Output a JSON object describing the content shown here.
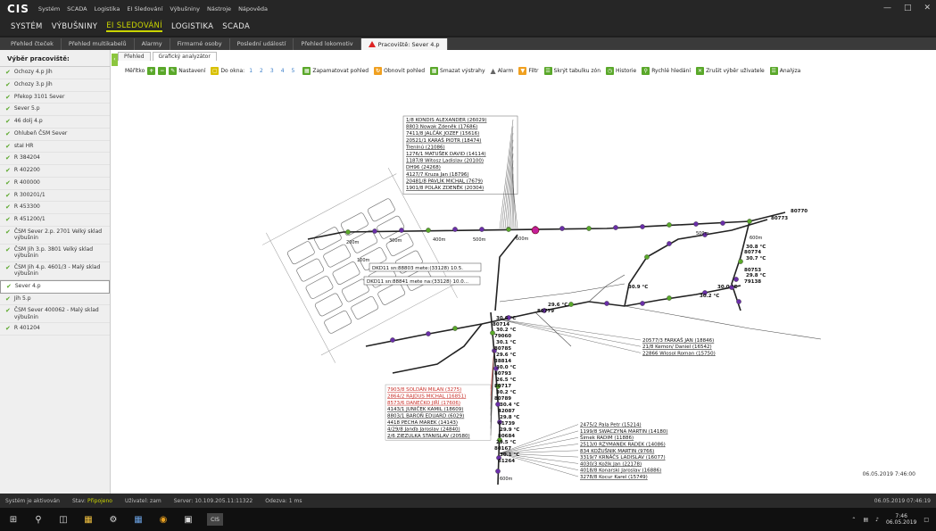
{
  "app": {
    "logo": "CIS",
    "top_menu": [
      "Systém",
      "SCADA",
      "Logistika",
      "EI Sledování",
      "Výbušniny",
      "Nástroje",
      "Nápověda"
    ],
    "main_menu": [
      "SYSTÉM",
      "VÝBUŠNINY",
      "EI SLEDOVÁNÍ",
      "LOGISTIKA",
      "SCADA"
    ],
    "active_main": "EI SLEDOVÁNÍ"
  },
  "tabs": [
    "Přehled čteček",
    "Přehled multikabelů",
    "Alarmy",
    "Firmarné osoby",
    "Poslední událostí",
    "Přehled lokomotiv",
    "Pracoviště: Sever 4.p"
  ],
  "sidebar": {
    "title": "Výběr pracoviště:",
    "items": [
      "Ochozy 4.p Jih",
      "Ochozy 3.p Jih",
      "Překop 3101 Sever",
      "Sever 5.p",
      "46 dolj 4.p",
      "Ohlubeň ČSM Sever",
      "staI HR",
      "R 384204",
      "R 402200",
      "R 400000",
      "R 300201/1",
      "R 453300",
      "R 451200/1",
      "ČSM Sever 2.p. 2701 Velký sklad výbušnin",
      "ČSM Jih 3.p. 3801 Velký sklad výbušnin",
      "ČSM Jih 4.p. 4601/3 - Malý sklad výbušnin",
      "Sever 4.p",
      "Jih 5.p",
      "ČSM Sever 400062 - Malý sklad výbušnin",
      "R 401204"
    ],
    "selected": "Sever 4.p"
  },
  "subtabs": [
    "Přehled",
    "Grafický analyzátor"
  ],
  "toolbar": {
    "meritko": "Měřítko",
    "nastaveni": "Nastavení",
    "do_okna": "Do okna:",
    "zoom_levels": [
      "1",
      "2",
      "3",
      "4",
      "5"
    ],
    "zapamatovat": "Zapamatovat pohled",
    "obnovit": "Obnovit pohled",
    "smazat": "Smazat výstrahy",
    "alarm": "Alarm",
    "filtr": "Filtr",
    "skryt": "Skrýt tabulku zón",
    "historie": "Historie",
    "rychle": "Rychlé hledání",
    "zrusit": "Zrušit výběr uživatele",
    "analyza": "Analýza"
  },
  "map": {
    "top_list": [
      "1/8 KONDIS ALEXANDER (26029)",
      "8803 Nowak Zdeněk (17686)",
      "7411/8 JALČÁK JOZEF (15616)",
      "20521/1 KARAŠ PIOTR (18474)",
      "Trenlnú (21086)",
      "1276/1 MATUŠEK DAVID (14114)",
      "1187/8 Witosz Ladislav (20100)",
      "DH96 (24268)",
      "4127/7 Kruza Jan (18796)",
      "20481/8 PAVLÍK MICHAL (7679)",
      "1901/8 POLÁK ZDENĚK (20304)"
    ],
    "mid_right_list": [
      "20577/3 FARKAŠ JAN (18846)",
      "21/8 Kemon/ Daniel (16542)",
      "22866 Wlosol Roman (15750)"
    ],
    "red_list": [
      "7903/8 SOLDÁN MILAN (3275)",
      "2864/2 RAJDUS MICHAL (16851)",
      "8573/6 DANEČKO JIŘÍ (17606)",
      "4143/1 JUNIČEK KAMIL (18609)",
      "8803/1 BAROŇ EDUARD (6029)",
      "4418 PECHA MAREK (14143)",
      "4/29/8 Janďa Jaroslav (24840)",
      "2/6 ZIEZULKA STANISLAV (20580)"
    ],
    "bottom_list": [
      "2475/2 Pala Petr (15214)",
      "1199/8 SWACZYNA MARTIN (14180)",
      "Šimek RADIM (11886)",
      "2513/0 RZYMANEK RADEK (14086)",
      "834 KOŽUŠNIK MARTIN (9766)",
      "3319/7 KRNÁČS LADISLAV (16077)",
      "4030/3 Kožík Jan (22178)",
      "4018/8 Konarski Jaroslav (16886)",
      "3278/8 Kocur Karel (15749)"
    ],
    "dkd_1": "DKD11 sn:88803 mete:(33128) 10.5.",
    "dkd_2": "DKD11 sn:88841 mete na:(33128) 10.0...",
    "node_ids": [
      "80774",
      "80753",
      "79138",
      "80714",
      "79060",
      "80785",
      "38814",
      "80793",
      "80717",
      "80789",
      "42087",
      "61739",
      "80684",
      "80167",
      "61264",
      "80773",
      "80770",
      "80779"
    ],
    "temps": [
      "30.8 °C",
      "30.7 °C",
      "29.8 °C",
      "30.6 °C",
      "30.2 °C",
      "30.1 °C",
      "29.6 °C",
      "30.0 °C",
      "26.5 °C",
      "30.2 °C",
      "30.4 °C",
      "29.8 °C",
      "29.9 °C",
      "29.5 °C",
      "30.1 °C",
      "30.2 °C",
      "30.0 °C",
      "29.6 °C",
      "30.9 °C"
    ],
    "dist_labels": [
      "200m",
      "300m",
      "400m",
      "500m",
      "600m",
      "500m",
      "600m",
      "100m",
      "600m"
    ],
    "timestamp": "06.05.2019 7:46:00"
  },
  "status": {
    "system": "Systém je aktivován",
    "stav_label": "Stav:",
    "stav_value": "Připojeno",
    "user": "Uživatel: zam",
    "server": "Server: 10.109.205.11:11322",
    "odezva": "Odezva: 1 ms",
    "right_time": "06.05.2019 07:46:19"
  },
  "taskbar": {
    "time": "7:46",
    "date": "06.05.2019"
  }
}
